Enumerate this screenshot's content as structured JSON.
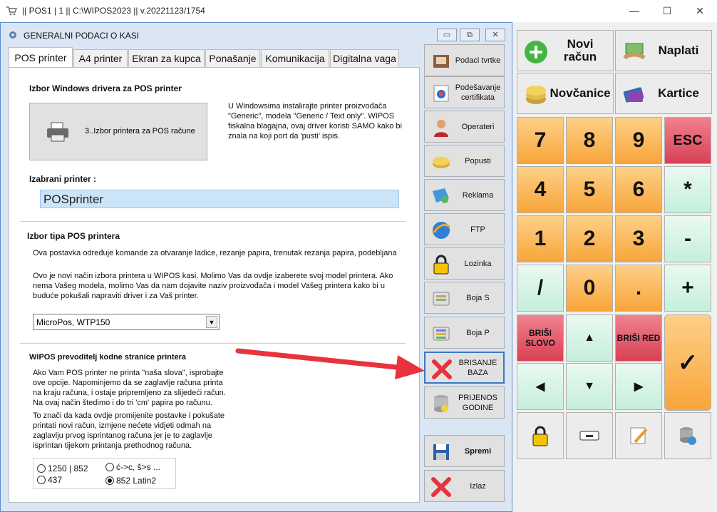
{
  "window": {
    "title": "|| POS1 | 1 || C:\\WIPOS2023 || v.20221123/1754",
    "min": "—",
    "max": "☐",
    "close": "✕"
  },
  "dialog": {
    "title": "GENERALNI PODACI O KASI",
    "min": "▭",
    "restore": "⧉",
    "close": "✕"
  },
  "tabs": [
    {
      "label": "POS printer"
    },
    {
      "label": "A4 printer"
    },
    {
      "label": "Ekran za kupca"
    },
    {
      "label": "Ponašanje"
    },
    {
      "label": "Komunikacija"
    },
    {
      "label": "Digitalna vaga"
    }
  ],
  "pos": {
    "driver_heading": "Izbor Windows drivera za POS printer",
    "select_button": "3..Izbor printera za POS račune",
    "driver_info": [
      "U Windowsima instalirajte printer proizvođača",
      "\"Generic\", modela \"Generic / Text  only\". WIPOS",
      "fiskalna blagajna, ovaj driver koristi SAMO kako bi",
      "znala na koji port da 'pusti' ispis."
    ],
    "selected_label": "Izabrani printer :",
    "selected_value": "POSprinter",
    "type_heading": "Izbor tipa POS printera",
    "type_desc": "Ova postavka određuje komande za otvaranje ladice, rezanje papira, trenutak rezanja papira, podebljana",
    "type_info": [
      "Ovo je novi način izbora printera u WIPOS kasi. Molimo Vas da ovdje izaberete svoj model printera. Ako",
      "nema Vašeg modela, molimo Vas da nam dojavite naziv proizvođača i model Vašeg printera kako bi u",
      "buduće pokušali napraviti driver i za Vaš printer."
    ],
    "model_value": "MicroPos, WTP150",
    "codepage_heading": "WIPOS prevoditelj kodne stranice printera",
    "codepage_info": [
      "Ako Vam POS printer ne printa \"naša slova\", isprobajte",
      "ove opcije. Napominjemo da se zaglavlje računa printa",
      "na kraju računa, i ostaje pripremljeno za slijedeći račun.",
      "Na ovaj način štedimo i do tri 'cm' papira po računu."
    ],
    "codepage_info2": [
      "To znači da kada ovdje promijenite postavke i pokušate",
      "printati novi račun, izmjene nećete vidjeti odmah na",
      "zaglavlju prvog isprintanog računa jer je to zaglavlje",
      "isprintan tijekom printanja prethodnog računa."
    ],
    "options": [
      {
        "label": "1250 | 852",
        "selected": false
      },
      {
        "label": "ć->c, š>s ...",
        "selected": false
      },
      {
        "label": "437",
        "selected": false
      },
      {
        "label": "852 Latin2",
        "selected": true
      }
    ]
  },
  "side": [
    {
      "label": "Podaci tvrtke",
      "icon": "book-icon"
    },
    {
      "label": "Podešavanje certifikata",
      "icon": "certificate-icon"
    },
    {
      "label": "Operateri",
      "icon": "operator-icon"
    },
    {
      "label": "Popusti",
      "icon": "coins-icon"
    },
    {
      "label": "Reklama",
      "icon": "ad-icon"
    },
    {
      "label": "FTP",
      "icon": "globe-icon"
    },
    {
      "label": "Lozinka",
      "icon": "lock-icon"
    },
    {
      "label": "Boja S",
      "icon": "color-icon"
    },
    {
      "label": "Boja P",
      "icon": "color-icon"
    },
    {
      "label": "BRISANJE BAZA",
      "icon": "delete-x-icon"
    },
    {
      "label": "PRIJENOS GODINE",
      "icon": "database-icon"
    },
    {
      "label": "Spremi",
      "icon": "floppy-icon"
    },
    {
      "label": "Izlaz",
      "icon": "exit-x-icon"
    }
  ],
  "pad": {
    "novi": "Novi račun",
    "naplati": "Naplati",
    "novcanice": "Novčanice",
    "kartice": "Kartice",
    "k7": "7",
    "k8": "8",
    "k9": "9",
    "esc": "ESC",
    "k4": "4",
    "k5": "5",
    "k6": "6",
    "star": "*",
    "k1": "1",
    "k2": "2",
    "k3": "3",
    "minus": "-",
    "slash": "/",
    "k0": "0",
    "dot": ".",
    "plus": "+",
    "brisi_slovo": "BRIŠI SLOVO",
    "brisi_red": "BRIŠI RED",
    "up": "▲",
    "down": "▼",
    "left": "◀",
    "right": "▶",
    "ok": "✓"
  },
  "colors": {
    "accent_red": "#e8323c",
    "orange": "#f8a53a",
    "mint": "#c5efdc",
    "pink": "#d94055"
  }
}
